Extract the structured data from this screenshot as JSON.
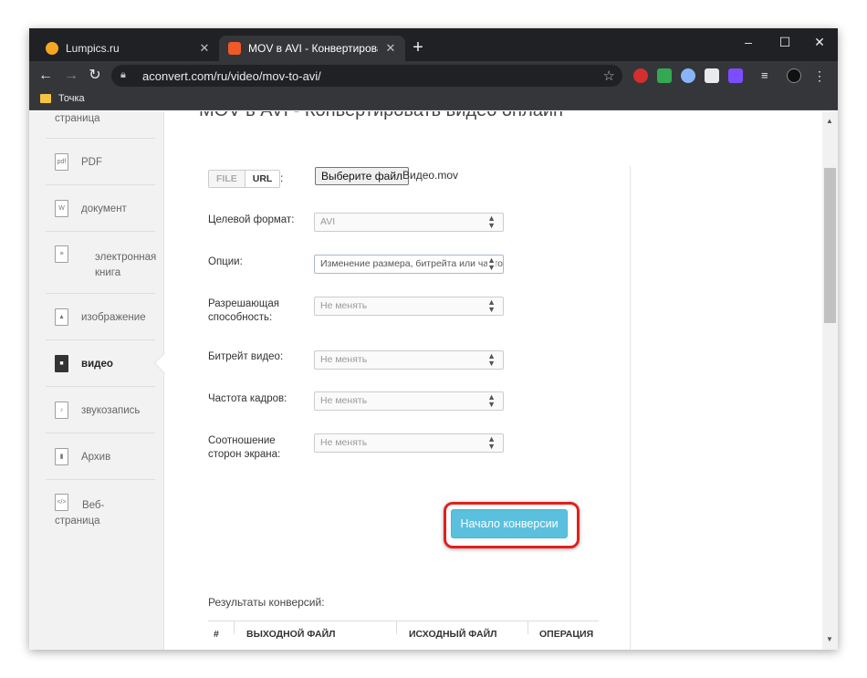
{
  "browser": {
    "tabs": [
      {
        "title": "Lumpics.ru",
        "favicon_color": "#f5a623"
      },
      {
        "title": "MOV в AVI - Конвертировать в",
        "favicon_color": "#f05a28"
      }
    ],
    "new_tab": "+",
    "url": "aconvert.com/ru/video/mov-to-avi/",
    "bookmark": "Точка",
    "window_controls": {
      "minimize": "–",
      "maximize": "☐",
      "close": "✕"
    },
    "extensions": [
      {
        "name": "opera-icon",
        "color": "#d32f2f"
      },
      {
        "name": "check-icon",
        "color": "#34a853"
      },
      {
        "name": "globe-icon",
        "color": "#8ab4f8"
      },
      {
        "name": "puzzle-icon",
        "color": "#e8eaed"
      },
      {
        "name": "ad-icon",
        "color": "#7c4dff"
      }
    ]
  },
  "sidebar": {
    "items": [
      {
        "label": "страница",
        "icon": "page-icon",
        "glyph": ""
      },
      {
        "label": "PDF",
        "icon": "pdf-icon",
        "glyph": "pdf"
      },
      {
        "label": "документ",
        "icon": "word-icon",
        "glyph": "W"
      },
      {
        "label": "электронная книга",
        "icon": "ebook-icon",
        "glyph": "≡"
      },
      {
        "label": "изображение",
        "icon": "image-icon",
        "glyph": "▲"
      },
      {
        "label": "видео",
        "icon": "video-icon",
        "glyph": "■"
      },
      {
        "label": "звукозапись",
        "icon": "audio-icon",
        "glyph": "♪"
      },
      {
        "label": "Архив",
        "icon": "archive-icon",
        "glyph": "▮"
      },
      {
        "label": "Веб-страница",
        "icon": "web-icon",
        "glyph": "</>"
      }
    ],
    "active": "видео"
  },
  "main": {
    "heading": "MOV в AVI - Конвертировать видео онлайн",
    "source_tabs": {
      "file": "FILE",
      "url": "URL",
      "colon": ":"
    },
    "choose_button": "Выберите файл",
    "file_name": "Видео.mov",
    "fields": [
      {
        "label": "Целевой формат:",
        "value": "AVI"
      },
      {
        "label": "Опции:",
        "value": "Изменение размера, битрейта или часто"
      },
      {
        "label": "Разрешающая способность:",
        "value": "Не менять"
      },
      {
        "label": "Битрейт видео:",
        "value": "Не менять"
      },
      {
        "label": "Частота кадров:",
        "value": "Не менять"
      },
      {
        "label": "Соотношение сторон экрана:",
        "value": "Не менять"
      }
    ],
    "start_button": "Начало конверсии",
    "results_title": "Результаты конверсий:",
    "table_headers": [
      "#",
      "ВЫХОДНОЙ ФАЙЛ",
      "ИСХОДНЫЙ ФАЙЛ",
      "ОПЕРАЦИЯ"
    ]
  },
  "colors": {
    "highlight": "#e0211b",
    "start_button": "#5bc0de"
  }
}
